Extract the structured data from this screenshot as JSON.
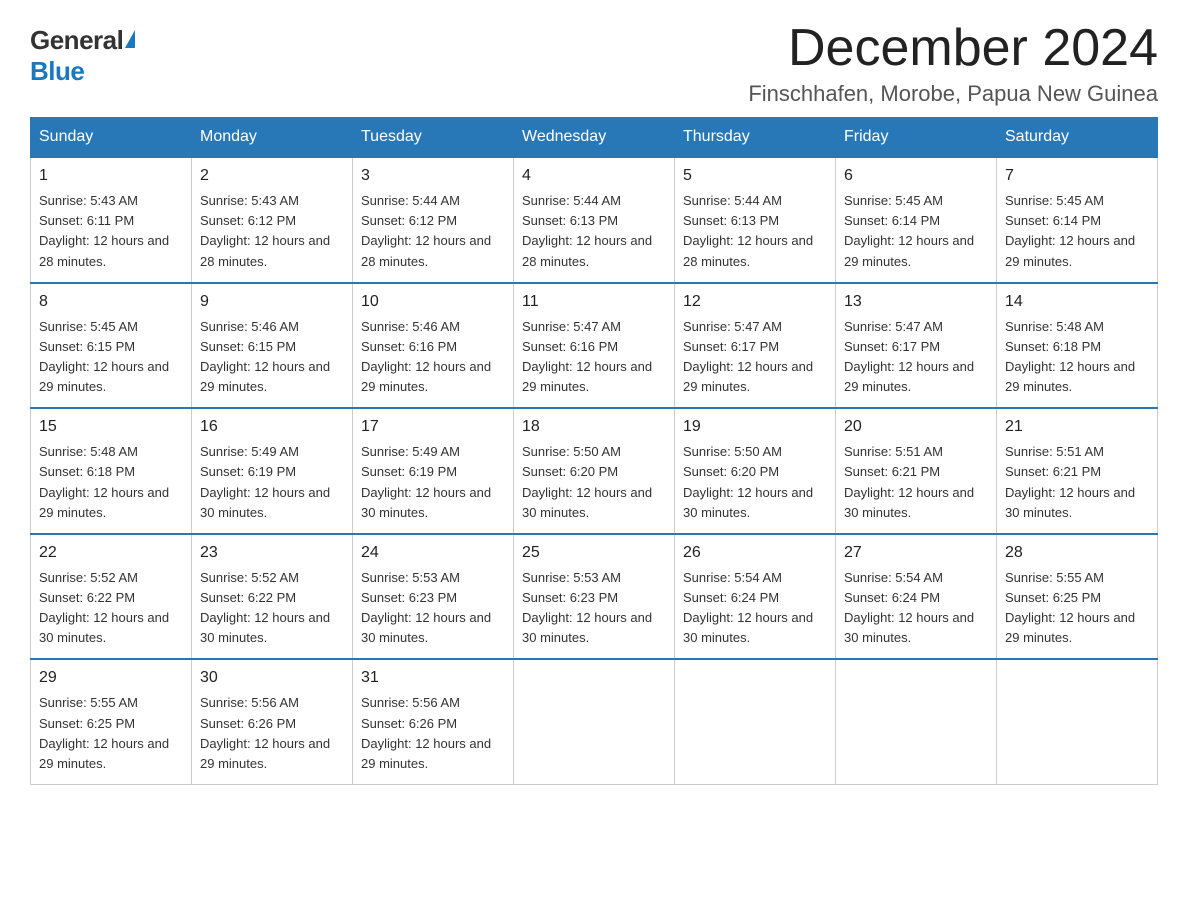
{
  "header": {
    "logo_general": "General",
    "logo_blue": "Blue",
    "month_title": "December 2024",
    "location": "Finschhafen, Morobe, Papua New Guinea"
  },
  "weekdays": [
    "Sunday",
    "Monday",
    "Tuesday",
    "Wednesday",
    "Thursday",
    "Friday",
    "Saturday"
  ],
  "weeks": [
    [
      {
        "day": "1",
        "sunrise": "5:43 AM",
        "sunset": "6:11 PM",
        "daylight": "12 hours and 28 minutes."
      },
      {
        "day": "2",
        "sunrise": "5:43 AM",
        "sunset": "6:12 PM",
        "daylight": "12 hours and 28 minutes."
      },
      {
        "day": "3",
        "sunrise": "5:44 AM",
        "sunset": "6:12 PM",
        "daylight": "12 hours and 28 minutes."
      },
      {
        "day": "4",
        "sunrise": "5:44 AM",
        "sunset": "6:13 PM",
        "daylight": "12 hours and 28 minutes."
      },
      {
        "day": "5",
        "sunrise": "5:44 AM",
        "sunset": "6:13 PM",
        "daylight": "12 hours and 28 minutes."
      },
      {
        "day": "6",
        "sunrise": "5:45 AM",
        "sunset": "6:14 PM",
        "daylight": "12 hours and 29 minutes."
      },
      {
        "day": "7",
        "sunrise": "5:45 AM",
        "sunset": "6:14 PM",
        "daylight": "12 hours and 29 minutes."
      }
    ],
    [
      {
        "day": "8",
        "sunrise": "5:45 AM",
        "sunset": "6:15 PM",
        "daylight": "12 hours and 29 minutes."
      },
      {
        "day": "9",
        "sunrise": "5:46 AM",
        "sunset": "6:15 PM",
        "daylight": "12 hours and 29 minutes."
      },
      {
        "day": "10",
        "sunrise": "5:46 AM",
        "sunset": "6:16 PM",
        "daylight": "12 hours and 29 minutes."
      },
      {
        "day": "11",
        "sunrise": "5:47 AM",
        "sunset": "6:16 PM",
        "daylight": "12 hours and 29 minutes."
      },
      {
        "day": "12",
        "sunrise": "5:47 AM",
        "sunset": "6:17 PM",
        "daylight": "12 hours and 29 minutes."
      },
      {
        "day": "13",
        "sunrise": "5:47 AM",
        "sunset": "6:17 PM",
        "daylight": "12 hours and 29 minutes."
      },
      {
        "day": "14",
        "sunrise": "5:48 AM",
        "sunset": "6:18 PM",
        "daylight": "12 hours and 29 minutes."
      }
    ],
    [
      {
        "day": "15",
        "sunrise": "5:48 AM",
        "sunset": "6:18 PM",
        "daylight": "12 hours and 29 minutes."
      },
      {
        "day": "16",
        "sunrise": "5:49 AM",
        "sunset": "6:19 PM",
        "daylight": "12 hours and 30 minutes."
      },
      {
        "day": "17",
        "sunrise": "5:49 AM",
        "sunset": "6:19 PM",
        "daylight": "12 hours and 30 minutes."
      },
      {
        "day": "18",
        "sunrise": "5:50 AM",
        "sunset": "6:20 PM",
        "daylight": "12 hours and 30 minutes."
      },
      {
        "day": "19",
        "sunrise": "5:50 AM",
        "sunset": "6:20 PM",
        "daylight": "12 hours and 30 minutes."
      },
      {
        "day": "20",
        "sunrise": "5:51 AM",
        "sunset": "6:21 PM",
        "daylight": "12 hours and 30 minutes."
      },
      {
        "day": "21",
        "sunrise": "5:51 AM",
        "sunset": "6:21 PM",
        "daylight": "12 hours and 30 minutes."
      }
    ],
    [
      {
        "day": "22",
        "sunrise": "5:52 AM",
        "sunset": "6:22 PM",
        "daylight": "12 hours and 30 minutes."
      },
      {
        "day": "23",
        "sunrise": "5:52 AM",
        "sunset": "6:22 PM",
        "daylight": "12 hours and 30 minutes."
      },
      {
        "day": "24",
        "sunrise": "5:53 AM",
        "sunset": "6:23 PM",
        "daylight": "12 hours and 30 minutes."
      },
      {
        "day": "25",
        "sunrise": "5:53 AM",
        "sunset": "6:23 PM",
        "daylight": "12 hours and 30 minutes."
      },
      {
        "day": "26",
        "sunrise": "5:54 AM",
        "sunset": "6:24 PM",
        "daylight": "12 hours and 30 minutes."
      },
      {
        "day": "27",
        "sunrise": "5:54 AM",
        "sunset": "6:24 PM",
        "daylight": "12 hours and 30 minutes."
      },
      {
        "day": "28",
        "sunrise": "5:55 AM",
        "sunset": "6:25 PM",
        "daylight": "12 hours and 29 minutes."
      }
    ],
    [
      {
        "day": "29",
        "sunrise": "5:55 AM",
        "sunset": "6:25 PM",
        "daylight": "12 hours and 29 minutes."
      },
      {
        "day": "30",
        "sunrise": "5:56 AM",
        "sunset": "6:26 PM",
        "daylight": "12 hours and 29 minutes."
      },
      {
        "day": "31",
        "sunrise": "5:56 AM",
        "sunset": "6:26 PM",
        "daylight": "12 hours and 29 minutes."
      },
      null,
      null,
      null,
      null
    ]
  ]
}
